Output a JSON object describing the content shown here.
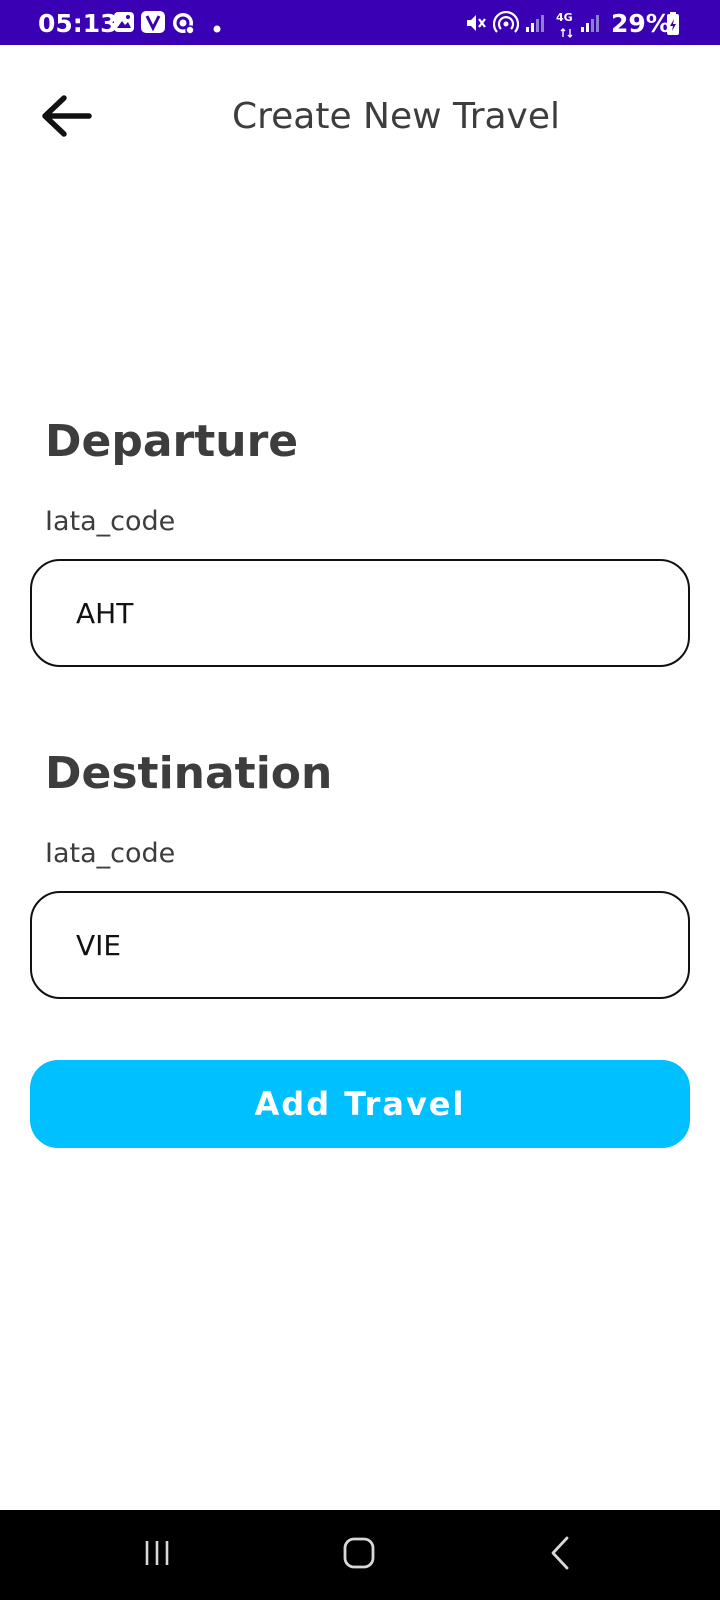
{
  "status_bar": {
    "time": "05:13",
    "network": "4G",
    "battery": "29%",
    "background_color": "#3a00b4",
    "icons": [
      "gallery-icon",
      "viber-icon",
      "sync-icon",
      "notification-dot-icon",
      "mute-icon",
      "hotspot-icon",
      "signal-icon",
      "signal-icon",
      "battery-icon"
    ]
  },
  "header": {
    "title": "Create New Travel",
    "back_icon": "arrow-left-icon"
  },
  "form": {
    "departure": {
      "heading": "Departure",
      "label": "Iata_code",
      "value": "AHT"
    },
    "destination": {
      "heading": "Destination",
      "label": "Iata_code",
      "value": "VIE"
    },
    "submit_label": "Add Travel",
    "accent_color": "#00c0ff"
  },
  "nav_bar": {
    "icons": [
      "recent-apps-icon",
      "home-icon",
      "back-icon"
    ]
  }
}
